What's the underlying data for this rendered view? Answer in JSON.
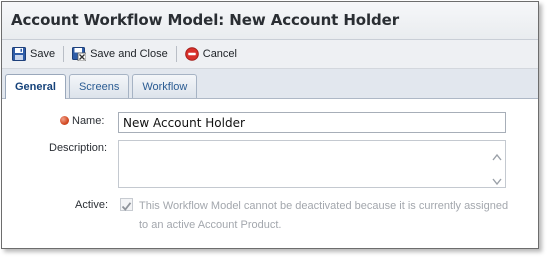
{
  "window": {
    "title": "Account Workflow Model: New Account Holder"
  },
  "toolbar": {
    "save_label": "Save",
    "save_close_label": "Save and Close",
    "cancel_label": "Cancel"
  },
  "tabs": [
    {
      "label": "General",
      "active": true
    },
    {
      "label": "Screens",
      "active": false
    },
    {
      "label": "Workflow",
      "active": false
    }
  ],
  "form": {
    "name_label": "Name:",
    "name_value": "New Account Holder",
    "description_label": "Description:",
    "description_value": "",
    "active_label": "Active:",
    "active_checked": true,
    "active_note": "This Workflow Model cannot be deactivated because it is currently assigned to an active Account Product."
  },
  "colors": {
    "accent": "#15427a",
    "tab_text": "#2b5c93",
    "required": "#d24a23",
    "cancel_red": "#d9302a"
  },
  "icons": [
    "save-icon",
    "save-and-close-icon",
    "cancel-icon",
    "required-indicator-icon",
    "checkmark-icon"
  ]
}
